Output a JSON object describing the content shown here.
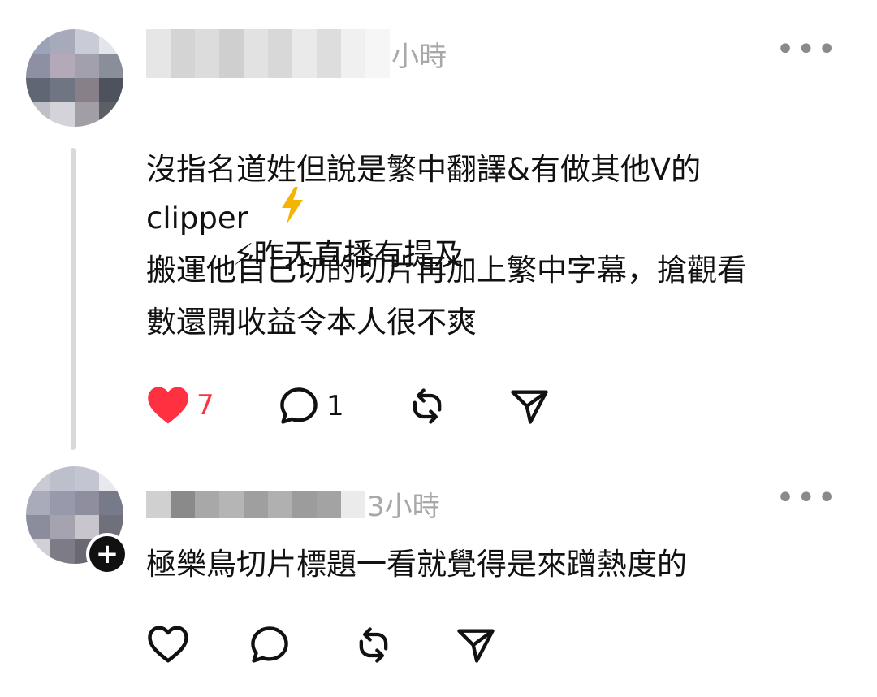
{
  "posts": [
    {
      "time": "小時",
      "more": "•••",
      "lines": [
        "⚡昨天直播有提及",
        "沒指名道姓但說是繁中翻譯&有做其他V的",
        "clipper",
        "搬運他自己切的切片再加上繁中字幕，搶觀看",
        "數還開收益令本人很不爽"
      ],
      "likes": "7",
      "liked": true,
      "replies": "1",
      "accent": "#ff3040"
    },
    {
      "time": "3小時",
      "more": "•••",
      "lines": [
        "極樂鳥切片標題一看就覺得是來蹭熱度的"
      ],
      "follow_badge": "+"
    }
  ],
  "icons": {
    "like": "heart-icon",
    "reply": "comment-icon",
    "repost": "repost-icon",
    "share": "send-icon",
    "more": "more-icon"
  }
}
